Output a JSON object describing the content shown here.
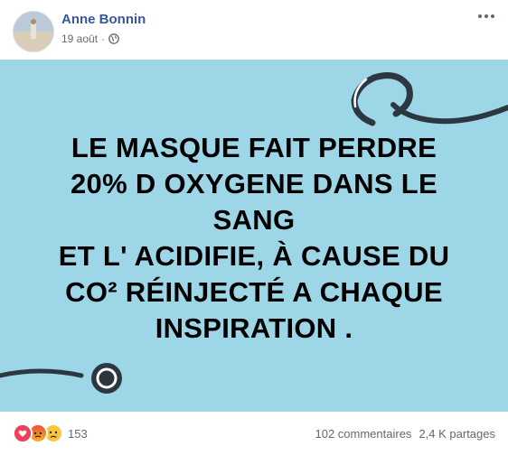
{
  "post": {
    "author": "Anne Bonnin",
    "date": "19 août",
    "separator": "·",
    "privacy_icon": "globe-icon",
    "menu_icon": "more-options-icon"
  },
  "image": {
    "background": "#9dd6e6",
    "lines": [
      "LE MASQUE FAIT PERDRE",
      "20% D OXYGENE DANS LE",
      "SANG",
      "ET L' ACIDIFIE, À CAUSE DU",
      "CO² RÉINJECTÉ A CHAQUE",
      "INSPIRATION ."
    ]
  },
  "footer": {
    "reaction_icons": [
      "love-reaction-icon",
      "angry-reaction-icon",
      "sad-reaction-icon"
    ],
    "reaction_count": "153",
    "comments": "102 commentaires",
    "shares": "2,4 K partages"
  }
}
